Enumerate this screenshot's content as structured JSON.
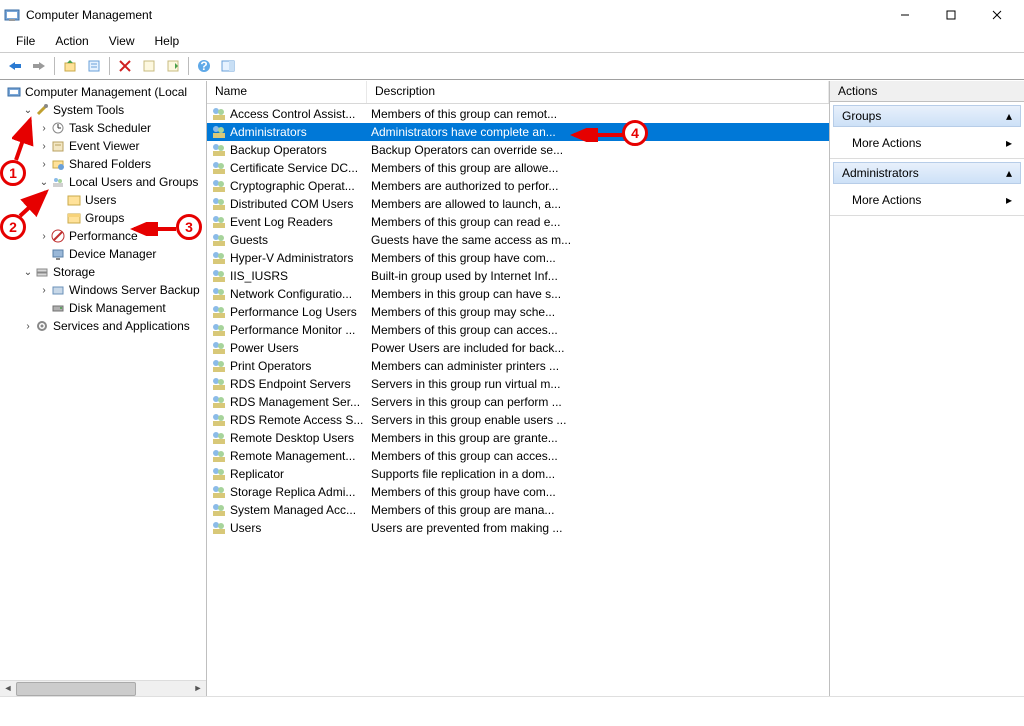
{
  "window": {
    "title": "Computer Management"
  },
  "menus": {
    "file": "File",
    "action": "Action",
    "view": "View",
    "help": "Help"
  },
  "tree": {
    "root": "Computer Management (Local",
    "system_tools": "System Tools",
    "task_scheduler": "Task Scheduler",
    "event_viewer": "Event Viewer",
    "shared_folders": "Shared Folders",
    "local_users_groups": "Local Users and Groups",
    "users": "Users",
    "groups": "Groups",
    "performance": "Performance",
    "device_manager": "Device Manager",
    "storage": "Storage",
    "win_server_backup": "Windows Server Backup",
    "disk_mgmt": "Disk Management",
    "services_apps": "Services and Applications"
  },
  "columns": {
    "name": "Name",
    "description": "Description"
  },
  "groups": [
    {
      "name": "Access Control Assist...",
      "desc": "Members of this group can remot..."
    },
    {
      "name": "Administrators",
      "desc": "Administrators have complete an...",
      "selected": true
    },
    {
      "name": "Backup Operators",
      "desc": "Backup Operators can override se..."
    },
    {
      "name": "Certificate Service DC...",
      "desc": "Members of this group are allowe..."
    },
    {
      "name": "Cryptographic Operat...",
      "desc": "Members are authorized to perfor..."
    },
    {
      "name": "Distributed COM Users",
      "desc": "Members are allowed to launch, a..."
    },
    {
      "name": "Event Log Readers",
      "desc": "Members of this group can read e..."
    },
    {
      "name": "Guests",
      "desc": "Guests have the same access as m..."
    },
    {
      "name": "Hyper-V Administrators",
      "desc": "Members of this group have com..."
    },
    {
      "name": "IIS_IUSRS",
      "desc": "Built-in group used by Internet Inf..."
    },
    {
      "name": "Network Configuratio...",
      "desc": "Members in this group can have s..."
    },
    {
      "name": "Performance Log Users",
      "desc": "Members of this group may sche..."
    },
    {
      "name": "Performance Monitor ...",
      "desc": "Members of this group can acces..."
    },
    {
      "name": "Power Users",
      "desc": "Power Users are included for back..."
    },
    {
      "name": "Print Operators",
      "desc": "Members can administer printers ..."
    },
    {
      "name": "RDS Endpoint Servers",
      "desc": "Servers in this group run virtual m..."
    },
    {
      "name": "RDS Management Ser...",
      "desc": "Servers in this group can perform ..."
    },
    {
      "name": "RDS Remote Access S...",
      "desc": "Servers in this group enable users ..."
    },
    {
      "name": "Remote Desktop Users",
      "desc": "Members in this group are grante..."
    },
    {
      "name": "Remote Management...",
      "desc": "Members of this group can acces..."
    },
    {
      "name": "Replicator",
      "desc": "Supports file replication in a dom..."
    },
    {
      "name": "Storage Replica Admi...",
      "desc": "Members of this group have com..."
    },
    {
      "name": "System Managed Acc...",
      "desc": "Members of this group are mana..."
    },
    {
      "name": "Users",
      "desc": "Users are prevented from making ..."
    }
  ],
  "actions": {
    "header": "Actions",
    "section1": {
      "title": "Groups",
      "item": "More Actions"
    },
    "section2": {
      "title": "Administrators",
      "item": "More Actions"
    }
  },
  "callouts": {
    "one": "1",
    "two": "2",
    "three": "3",
    "four": "4"
  }
}
